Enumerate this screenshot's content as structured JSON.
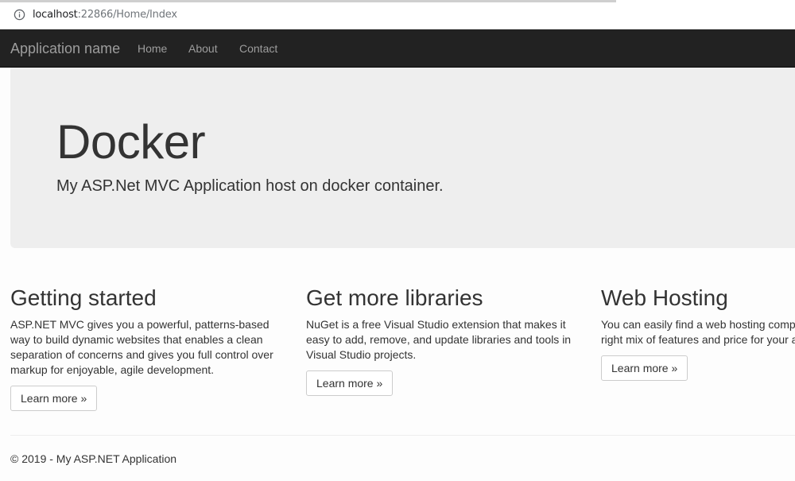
{
  "browser": {
    "url_host": "localhost",
    "url_rest": ":22866/Home/Index"
  },
  "navbar": {
    "brand": "Application name",
    "links": [
      "Home",
      "About",
      "Contact"
    ]
  },
  "jumbotron": {
    "title": "Docker",
    "lead": "My ASP.Net MVC Application host on docker container."
  },
  "columns": [
    {
      "heading": "Getting started",
      "text": "ASP.NET MVC gives you a powerful, patterns-based way to build dynamic websites that enables a clean separation of concerns and gives you full control over markup for enjoyable, agile development.",
      "button": "Learn more »"
    },
    {
      "heading": "Get more libraries",
      "text": "NuGet is a free Visual Studio extension that makes it easy to add, remove, and update libraries and tools in Visual Studio projects.",
      "button": "Learn more »"
    },
    {
      "heading": "Web Hosting",
      "text_line1": "You can easily find a web hosting compar",
      "text_line2": "right mix of features and price for your ap",
      "button": "Learn more »"
    }
  ],
  "footer": {
    "text": "© 2019 - My ASP.NET Application"
  }
}
